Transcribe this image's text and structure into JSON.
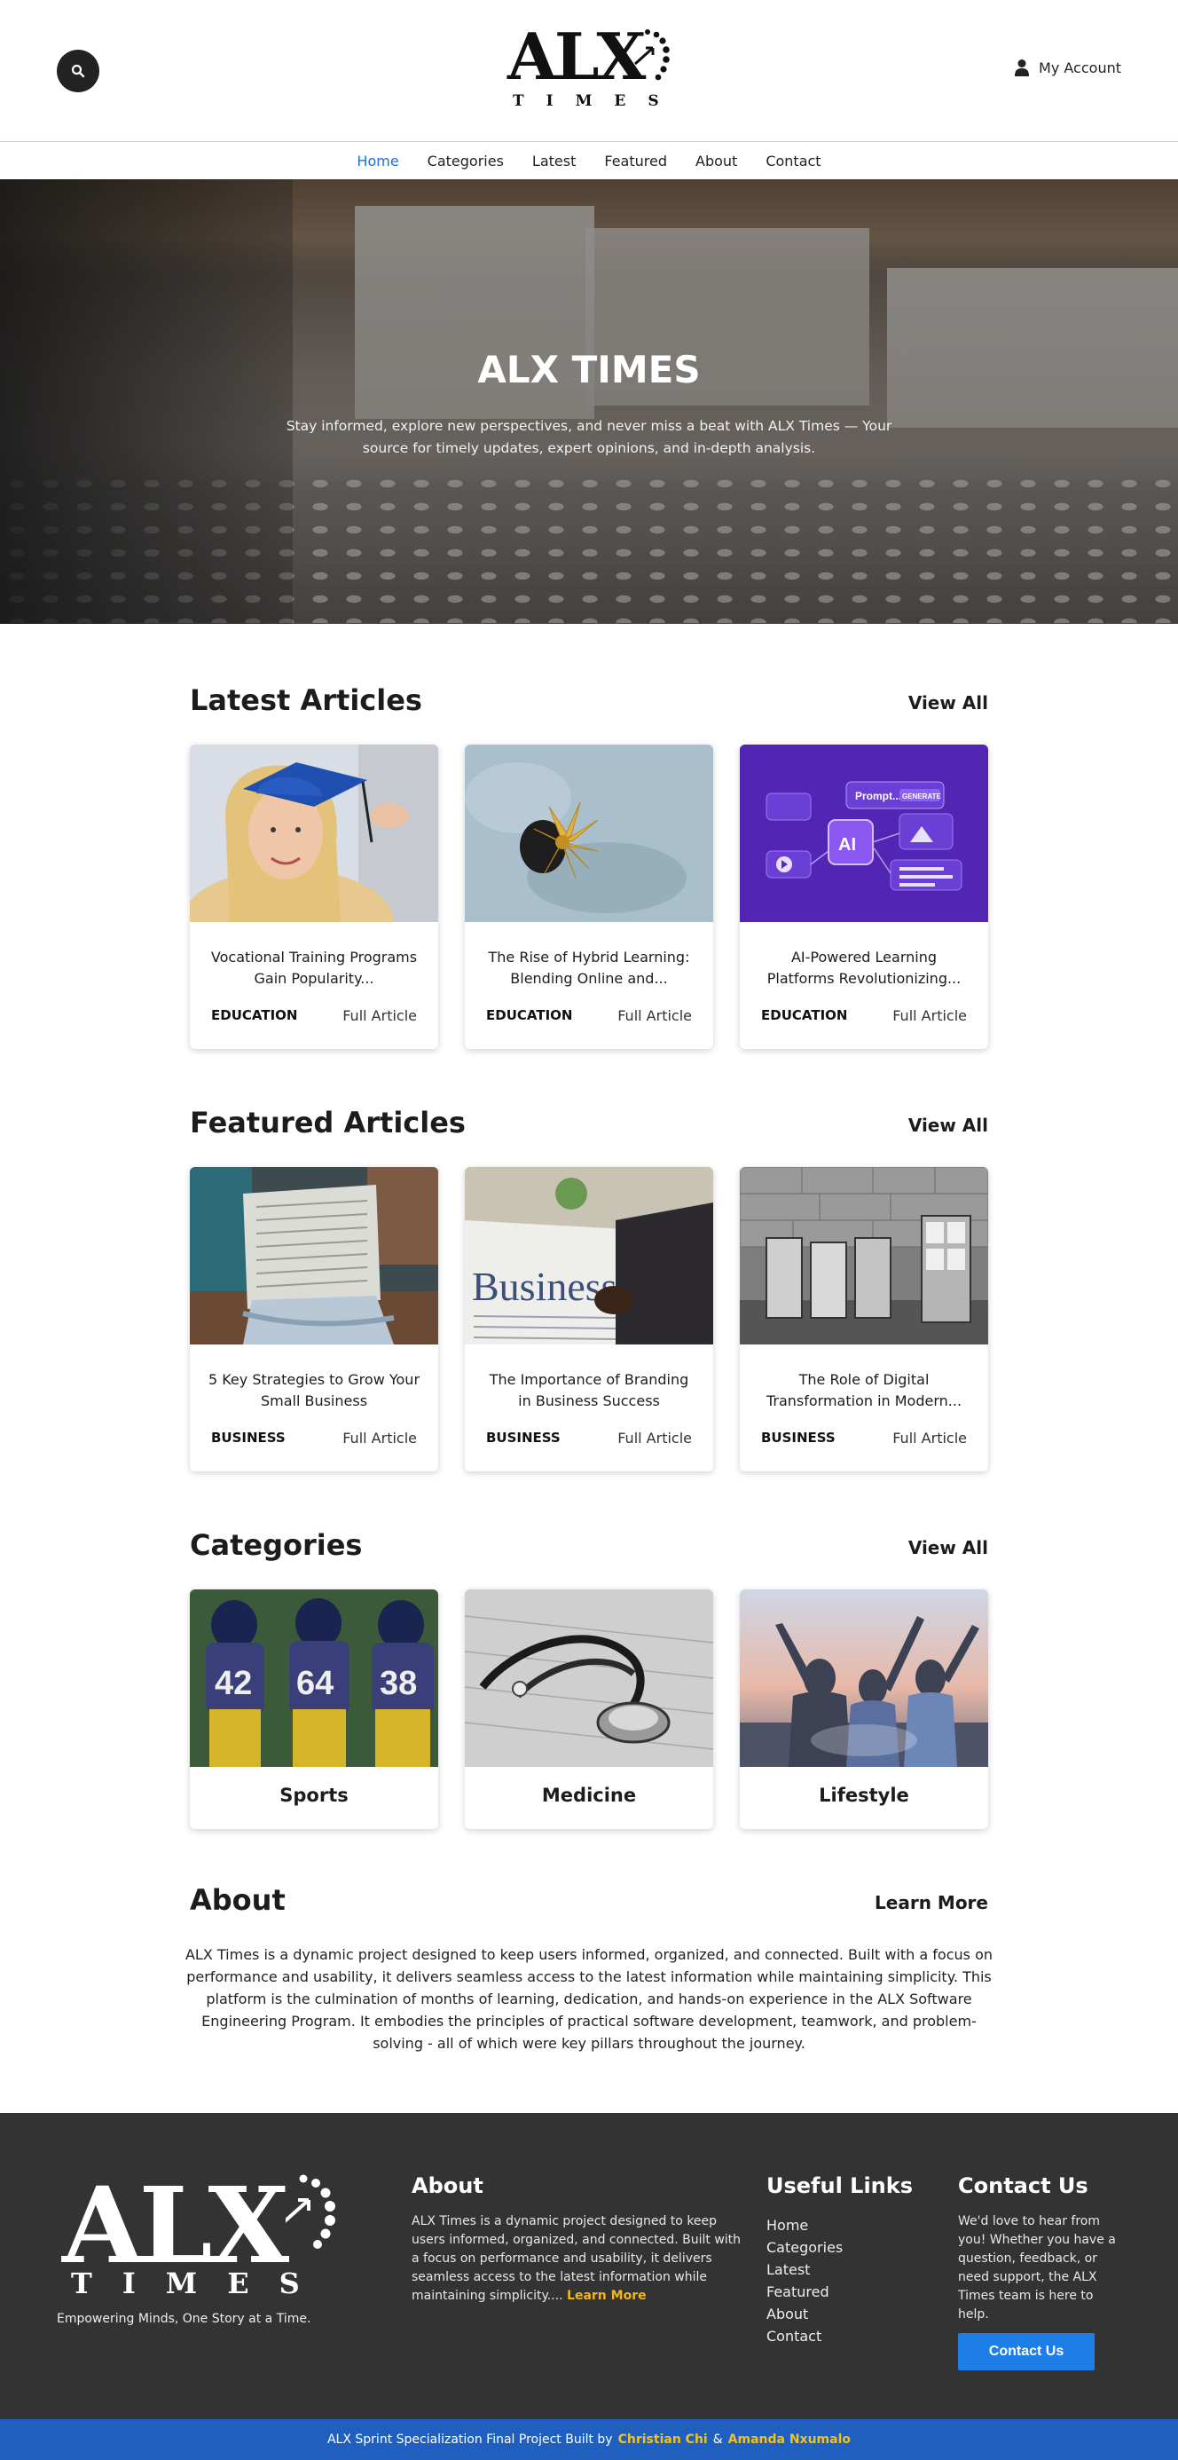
{
  "header": {
    "logo_main": "ALX",
    "logo_sub": "TIMES",
    "account_label": "My Account"
  },
  "nav": {
    "items": [
      "Home",
      "Categories",
      "Latest",
      "Featured",
      "About",
      "Contact"
    ],
    "active": "Home"
  },
  "hero": {
    "title": "ALX TIMES",
    "text": "Stay informed, explore new perspectives, and never miss a beat with ALX Times — Your source for timely updates, expert opinions, and in-depth analysis."
  },
  "latest": {
    "title": "Latest Articles",
    "link": "View All",
    "cards": [
      {
        "title": "Vocational Training Programs Gain Popularity...",
        "category": "EDUCATION",
        "action": "Full Article"
      },
      {
        "title": "The Rise of Hybrid Learning: Blending Online and...",
        "category": "EDUCATION",
        "action": "Full Article"
      },
      {
        "title": "AI-Powered Learning Platforms Revolutionizing...",
        "category": "EDUCATION",
        "action": "Full Article"
      }
    ]
  },
  "featured": {
    "title": "Featured Articles",
    "link": "View All",
    "cards": [
      {
        "title": "5 Key Strategies to Grow Your Small Business",
        "category": "BUSINESS",
        "action": "Full Article"
      },
      {
        "title": "The Importance of Branding in Business Success",
        "category": "BUSINESS",
        "action": "Full Article"
      },
      {
        "title": "The Role of Digital Transformation in Modern...",
        "category": "BUSINESS",
        "action": "Full Article"
      }
    ]
  },
  "categories": {
    "title": "Categories",
    "link": "View All",
    "items": [
      "Sports",
      "Medicine",
      "Lifestyle"
    ]
  },
  "about": {
    "title": "About",
    "link": "Learn More",
    "text": "ALX Times is a dynamic project designed to keep users informed, organized, and connected. Built with a focus on performance and usability, it delivers seamless access to the latest information while maintaining simplicity. This platform is the culmination of months of learning, dedication, and hands-on experience in the ALX Software Engineering Program. It embodies the principles of practical software development, teamwork, and problem-solving - all of which were key pillars throughout the journey."
  },
  "images": {
    "ai_prompt_label": "Prompt...",
    "ai_generate_label": "GENERATE",
    "ai_chip_label": "AI",
    "newspaper_headline": "Business",
    "jersey_numbers": [
      "42",
      "64",
      "38"
    ]
  },
  "footer": {
    "logo_main": "ALX",
    "logo_sub": "TIMES",
    "tagline": "Empowering Minds, One Story at a Time.",
    "about_title": "About",
    "about_text": "ALX Times is a dynamic project designed to keep users informed, organized, and connected. Built with a focus on performance and usability, it delivers seamless access to the latest information while maintaining simplicity....",
    "about_link": "Learn More",
    "links_title": "Useful Links",
    "links": [
      "Home",
      "Categories",
      "Latest",
      "Featured",
      "About",
      "Contact"
    ],
    "contact_title": "Contact Us",
    "contact_text": "We'd love to hear from you! Whether you have a question, feedback, or need support, the ALX Times team is here to help.",
    "contact_button": "Contact Us"
  },
  "bottom_bar": {
    "prefix": "ALX Sprint Specialization Final Project Built by",
    "author1": "Christian Chi",
    "separator": "&",
    "author2": "Amanda Nxumalo"
  }
}
